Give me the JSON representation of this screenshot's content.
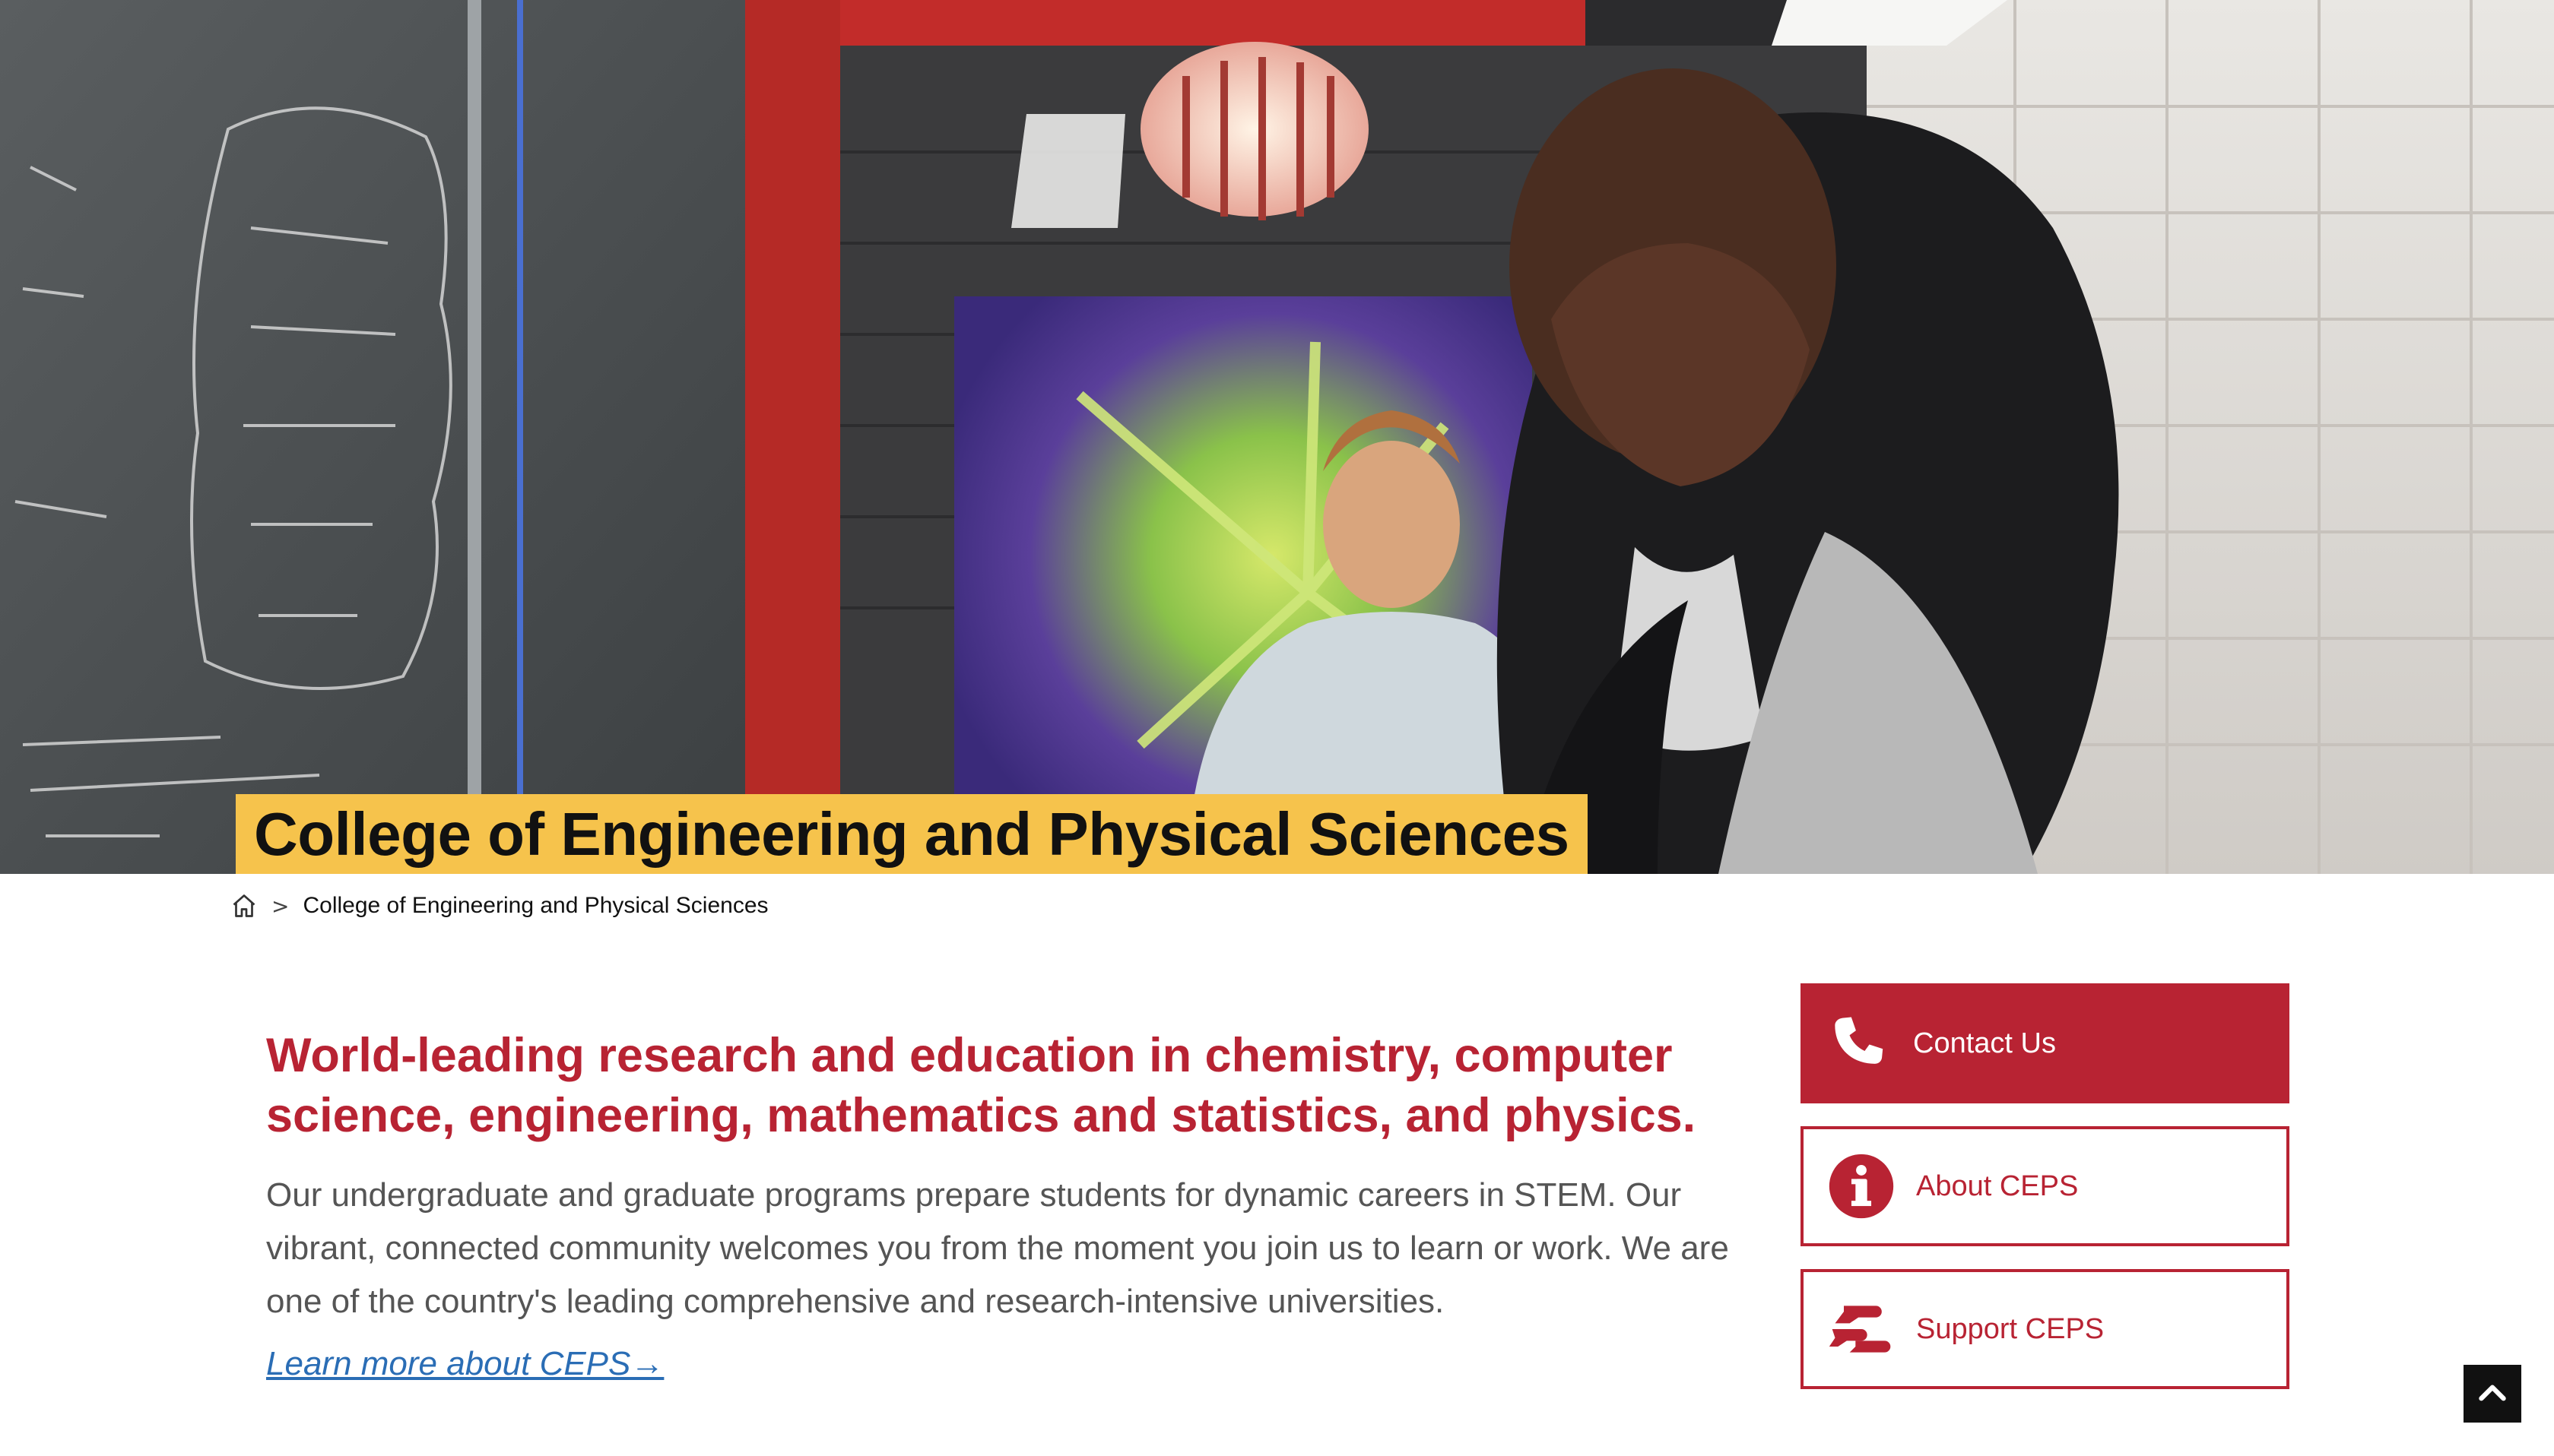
{
  "hero": {
    "title": "College of Engineering and Physical Sciences"
  },
  "breadcrumb": {
    "home_icon": "home-icon",
    "separator": ">",
    "current": "College of Engineering and Physical Sciences"
  },
  "main": {
    "headline": "World-leading research and education in chemistry, computer science, engineering, mathematics and statistics, and physics.",
    "body": "Our undergraduate and graduate programs prepare students for dynamic careers in STEM. Our vibrant, connected community welcomes you from the moment you join us to learn or work. We are one of the country's leading comprehensive and research-intensive universities.",
    "learn_more": "Learn more about CEPS→"
  },
  "sidebar": {
    "buttons": [
      {
        "label": "Contact Us",
        "icon": "phone-icon"
      },
      {
        "label": "About CEPS",
        "icon": "info-icon"
      },
      {
        "label": "Support CEPS",
        "icon": "helping-hands-icon"
      }
    ]
  },
  "back_to_top": {
    "icon": "chevron-up-icon"
  },
  "colors": {
    "brand_red": "#b82333",
    "title_highlight": "#f6c34c",
    "link_blue": "#2a6db5"
  }
}
